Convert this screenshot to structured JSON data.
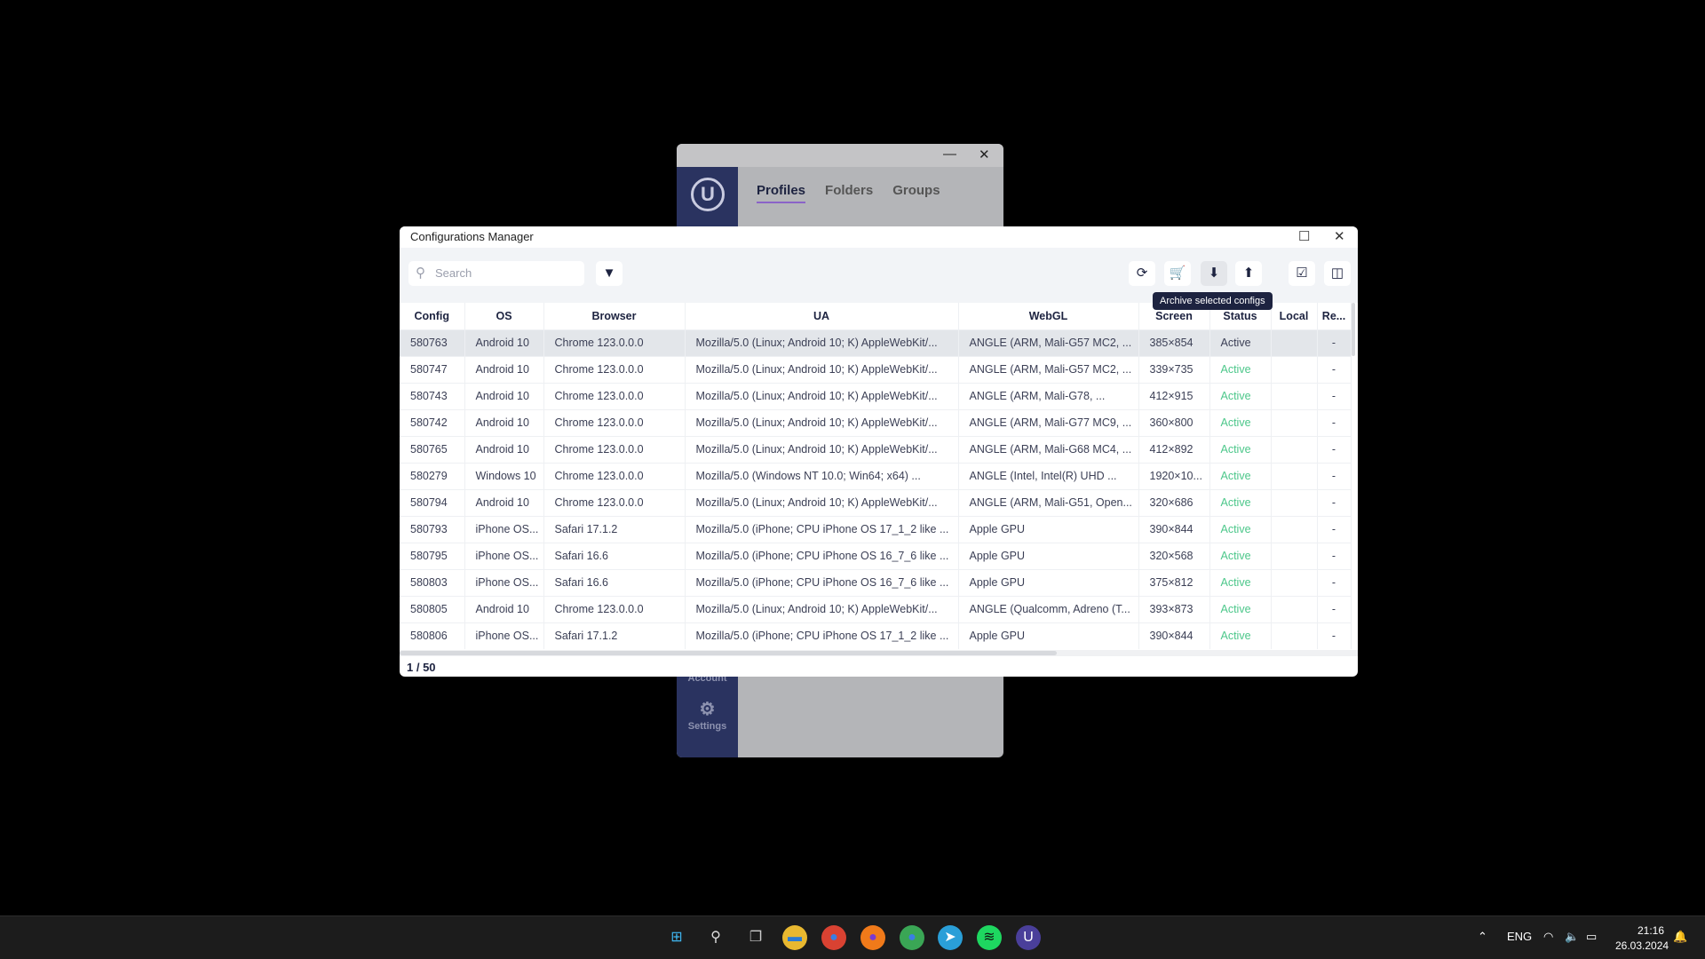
{
  "back_window": {
    "tabs": [
      "Profiles",
      "Folders",
      "Groups"
    ],
    "account_label": "Account",
    "settings_label": "Settings",
    "minimize": "—",
    "close": "✕"
  },
  "dialog": {
    "title": "Configurations Manager",
    "maximize": "☐",
    "close": "✕",
    "search_placeholder": "Search",
    "toolbar": [
      {
        "icon": "refresh-icon",
        "glyph": "⟳"
      },
      {
        "icon": "cart-icon",
        "glyph": "🛒"
      },
      {
        "icon": "archive-down-icon",
        "glyph": "⬇"
      },
      {
        "icon": "archive-up-icon",
        "glyph": "⬆"
      },
      {
        "icon": "select-all-icon",
        "glyph": "☑"
      },
      {
        "icon": "columns-icon",
        "glyph": "◫"
      }
    ],
    "tooltip": "Archive selected configs",
    "columns": [
      "Config",
      "OS",
      "Browser",
      "UA",
      "WebGL",
      "Screen",
      "Status",
      "Local",
      "Re..."
    ],
    "rows": [
      [
        "580763",
        "Android 10",
        "Chrome 123.0.0.0",
        "Mozilla/5.0 (Linux; Android 10; K) AppleWebKit/...",
        "ANGLE (ARM, Mali-G57 MC2, ...",
        "385×854",
        "Active",
        "",
        "-"
      ],
      [
        "580747",
        "Android 10",
        "Chrome 123.0.0.0",
        "Mozilla/5.0 (Linux; Android 10; K) AppleWebKit/...",
        "ANGLE (ARM, Mali-G57 MC2, ...",
        "339×735",
        "Active",
        "",
        "-"
      ],
      [
        "580743",
        "Android 10",
        "Chrome 123.0.0.0",
        "Mozilla/5.0 (Linux; Android 10; K) AppleWebKit/...",
        "ANGLE (ARM, Mali-G78, ...",
        "412×915",
        "Active",
        "",
        "-"
      ],
      [
        "580742",
        "Android 10",
        "Chrome 123.0.0.0",
        "Mozilla/5.0 (Linux; Android 10; K) AppleWebKit/...",
        "ANGLE (ARM, Mali-G77 MC9, ...",
        "360×800",
        "Active",
        "",
        "-"
      ],
      [
        "580765",
        "Android 10",
        "Chrome 123.0.0.0",
        "Mozilla/5.0 (Linux; Android 10; K) AppleWebKit/...",
        "ANGLE (ARM, Mali-G68 MC4, ...",
        "412×892",
        "Active",
        "",
        "-"
      ],
      [
        "580279",
        "Windows 10",
        "Chrome 123.0.0.0",
        "Mozilla/5.0 (Windows NT 10.0; Win64; x64) ...",
        "ANGLE (Intel, Intel(R) UHD ...",
        "1920×10...",
        "Active",
        "",
        "-"
      ],
      [
        "580794",
        "Android 10",
        "Chrome 123.0.0.0",
        "Mozilla/5.0 (Linux; Android 10; K) AppleWebKit/...",
        "ANGLE (ARM, Mali-G51, Open...",
        "320×686",
        "Active",
        "",
        "-"
      ],
      [
        "580793",
        "iPhone OS...",
        "Safari 17.1.2",
        "Mozilla/5.0 (iPhone; CPU iPhone OS 17_1_2 like ...",
        "Apple GPU",
        "390×844",
        "Active",
        "",
        "-"
      ],
      [
        "580795",
        "iPhone OS...",
        "Safari 16.6",
        "Mozilla/5.0 (iPhone; CPU iPhone OS 16_7_6 like ...",
        "Apple GPU",
        "320×568",
        "Active",
        "",
        "-"
      ],
      [
        "580803",
        "iPhone OS...",
        "Safari 16.6",
        "Mozilla/5.0 (iPhone; CPU iPhone OS 16_7_6 like ...",
        "Apple GPU",
        "375×812",
        "Active",
        "",
        "-"
      ],
      [
        "580805",
        "Android 10",
        "Chrome 123.0.0.0",
        "Mozilla/5.0 (Linux; Android 10; K) AppleWebKit/...",
        "ANGLE (Qualcomm, Adreno (T...",
        "393×873",
        "Active",
        "",
        "-"
      ],
      [
        "580806",
        "iPhone OS...",
        "Safari 17.1.2",
        "Mozilla/5.0 (iPhone; CPU iPhone OS 17_1_2 like ...",
        "Apple GPU",
        "390×844",
        "Active",
        "",
        "-"
      ]
    ],
    "selected_row": 0,
    "pagination": "1 / 50"
  },
  "colors": {
    "active_status": "#4cc78a",
    "accent": "#1d2340"
  },
  "taskbar": {
    "apps": [
      {
        "icon": "windows-start-icon",
        "glyph": "⊞",
        "bg": "#1c1c1c",
        "fg": "#3fb6f0"
      },
      {
        "icon": "search-icon",
        "glyph": "⚲",
        "bg": "#1c1c1c",
        "fg": "#ddd"
      },
      {
        "icon": "task-view-icon",
        "glyph": "❐",
        "bg": "#1c1c1c",
        "fg": "#ccc"
      },
      {
        "icon": "file-explorer-icon",
        "glyph": "▬",
        "bg": "#e8b830",
        "fg": "#2a7bd4"
      },
      {
        "icon": "chrome-icon",
        "glyph": "●",
        "bg": "#d94232",
        "fg": "#3a7ee4"
      },
      {
        "icon": "firefox-icon",
        "glyph": "●",
        "bg": "#f07a1a",
        "fg": "#7a3ad0"
      },
      {
        "icon": "chrome-profile-icon",
        "glyph": "●",
        "bg": "#3aa655",
        "fg": "#3a7ee4"
      },
      {
        "icon": "telegram-icon",
        "glyph": "➤",
        "bg": "#2a9fd8",
        "fg": "#fff"
      },
      {
        "icon": "spotify-icon",
        "glyph": "≋",
        "bg": "#1ed760",
        "fg": "#111"
      },
      {
        "icon": "undetectable-icon",
        "glyph": "U",
        "bg": "#4a3f9a",
        "fg": "#fff"
      }
    ],
    "language": "ENG",
    "time": "21:16",
    "date": "26.03.2024"
  }
}
